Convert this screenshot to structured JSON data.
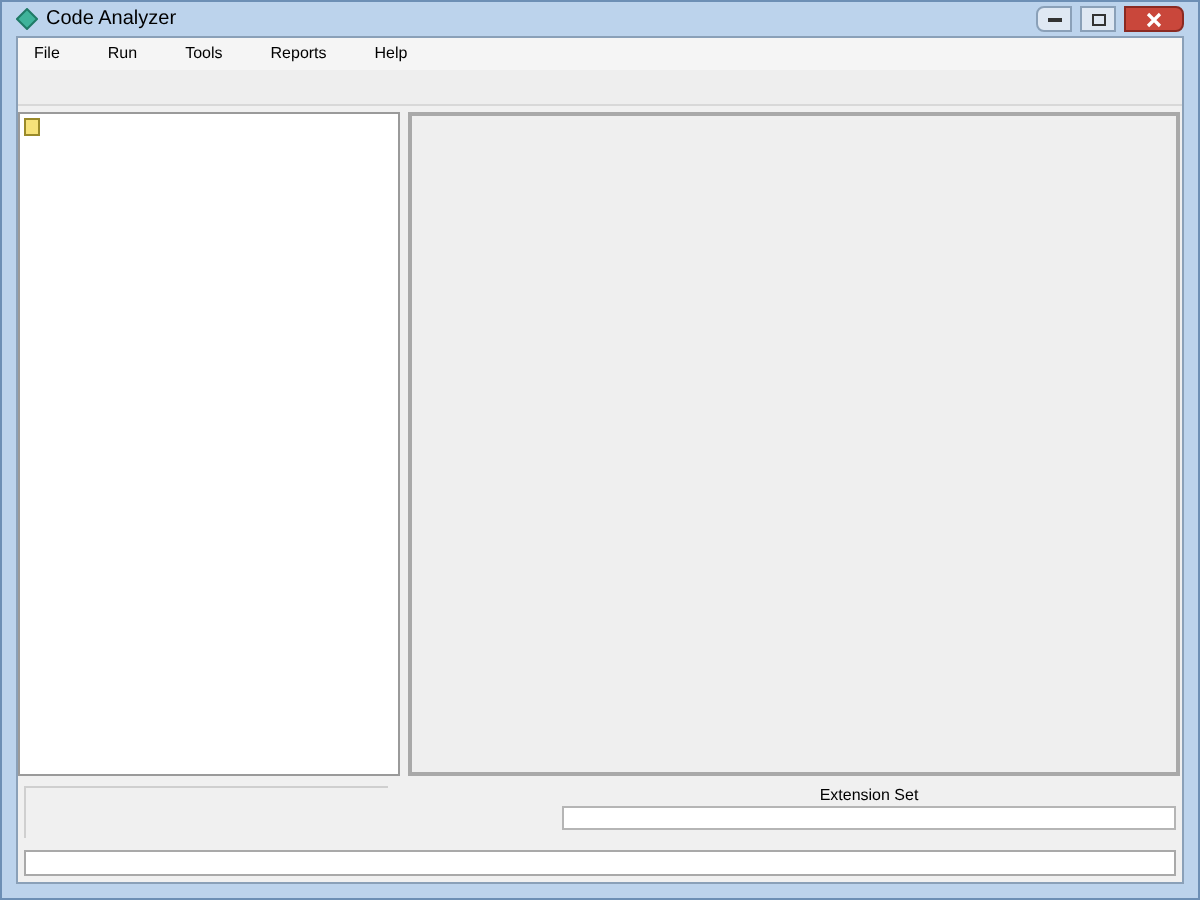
{
  "window": {
    "title": "Code Analyzer"
  },
  "menu": [
    "File",
    "Run",
    "Tools",
    "Reports",
    "Help"
  ],
  "bottom": {
    "label": "Extension Set"
  }
}
